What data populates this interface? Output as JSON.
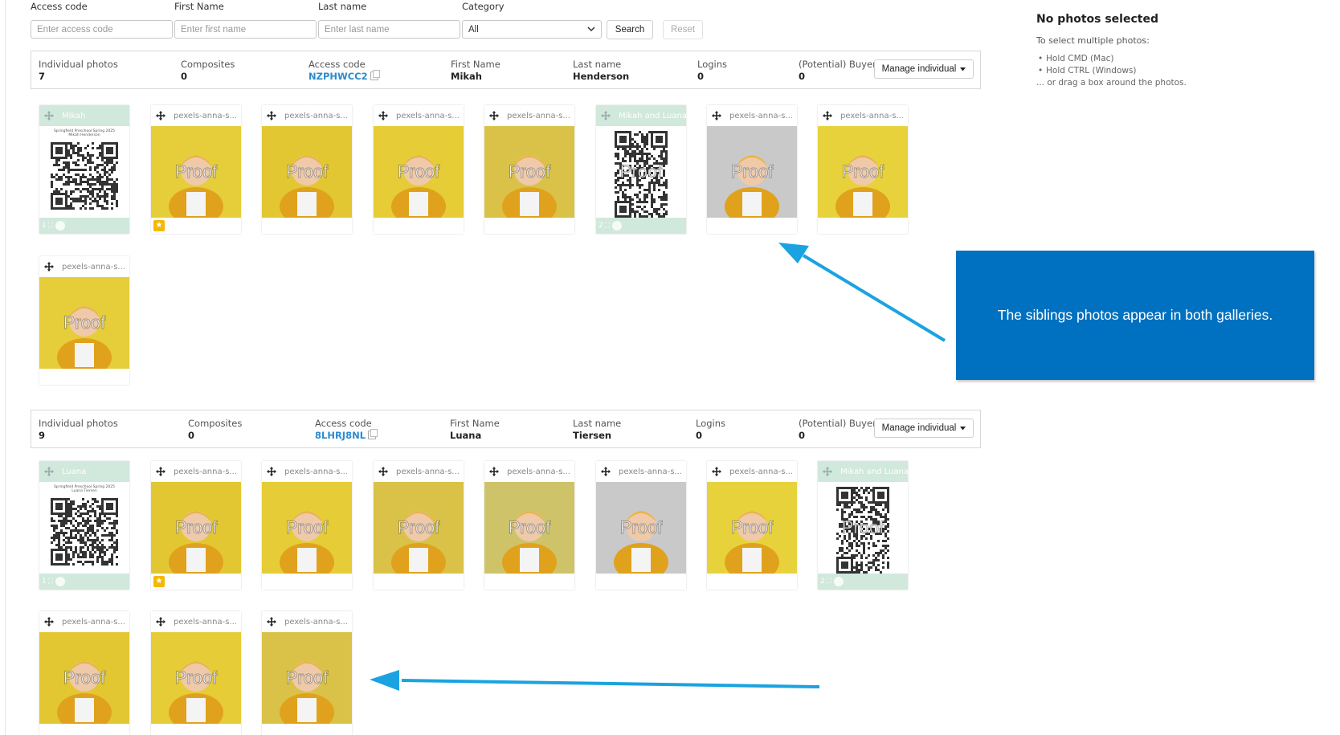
{
  "filters": {
    "access_code_label": "Access code",
    "access_code_placeholder": "Enter access code",
    "first_name_label": "First Name",
    "first_name_placeholder": "Enter first name",
    "last_name_label": "Last name",
    "last_name_placeholder": "Enter last name",
    "category_label": "Category",
    "category_value": "All",
    "search_label": "Search",
    "reset_label": "Reset"
  },
  "galleries": [
    {
      "headers": {
        "individual": "Individual photos",
        "composites": "Composites",
        "access_code": "Access code",
        "first_name": "First Name",
        "last_name": "Last name",
        "logins": "Logins",
        "buyer": "(Potential) Buyer"
      },
      "individual_count": "7",
      "composites_count": "0",
      "access_code": "NZPHWCC2",
      "first_name": "Mikah",
      "last_name": "Henderson",
      "logins": "0",
      "buyer": "0",
      "manage_label": "Manage individual",
      "cards": [
        {
          "title": "Mikah",
          "type": "composite",
          "badge": "1",
          "header_line": "Springfield Preschool Spring 2025",
          "sub_line": "Mikah Henderson"
        },
        {
          "title": "pexels-anna-s...",
          "type": "photo",
          "starred": true,
          "watermark": "Proof"
        },
        {
          "title": "pexels-anna-s...",
          "type": "photo",
          "watermark": "Proof"
        },
        {
          "title": "pexels-anna-s...",
          "type": "photo",
          "watermark": "Proof"
        },
        {
          "title": "pexels-anna-s...",
          "type": "photo",
          "watermark": "Proof"
        },
        {
          "title": "Mikah and Luana",
          "type": "composite",
          "badge": "2",
          "watermark": "Proof"
        },
        {
          "title": "pexels-anna-s...",
          "type": "photo",
          "watermark": "Proof"
        },
        {
          "title": "pexels-anna-s...",
          "type": "photo",
          "watermark": "Proof"
        },
        {
          "title": "pexels-anna-s...",
          "type": "photo",
          "watermark": "Proof"
        }
      ]
    },
    {
      "headers": {
        "individual": "Individual photos",
        "composites": "Composites",
        "access_code": "Access code",
        "first_name": "First Name",
        "last_name": "Last name",
        "logins": "Logins",
        "buyer": "(Potential) Buyer"
      },
      "individual_count": "9",
      "composites_count": "0",
      "access_code": "8LHRJ8NL",
      "first_name": "Luana",
      "last_name": "Tiersen",
      "logins": "0",
      "buyer": "0",
      "manage_label": "Manage individual",
      "cards": [
        {
          "title": "Luana",
          "type": "composite",
          "badge": "1",
          "header_line": "Springfield Preschool Spring 2025",
          "sub_line": "Luana Tiersen"
        },
        {
          "title": "pexels-anna-s...",
          "type": "photo",
          "starred": true,
          "watermark": "Proof"
        },
        {
          "title": "pexels-anna-s...",
          "type": "photo",
          "watermark": "Proof"
        },
        {
          "title": "pexels-anna-s...",
          "type": "photo",
          "watermark": "Proof"
        },
        {
          "title": "pexels-anna-s...",
          "type": "photo",
          "watermark": "Proof"
        },
        {
          "title": "pexels-anna-s...",
          "type": "photo",
          "watermark": "Proof"
        },
        {
          "title": "pexels-anna-s...",
          "type": "photo",
          "watermark": "Proof"
        },
        {
          "title": "Mikah and Luana",
          "type": "composite",
          "badge": "2",
          "watermark": "Proof"
        },
        {
          "title": "pexels-anna-s...",
          "type": "photo",
          "watermark": "Proof"
        },
        {
          "title": "pexels-anna-s...",
          "type": "photo",
          "watermark": "Proof"
        },
        {
          "title": "pexels-anna-s...",
          "type": "photo",
          "watermark": "Proof"
        }
      ]
    }
  ],
  "panel": {
    "title": "No photos selected",
    "intro": "To select multiple photos:",
    "tip1": "Hold CMD (Mac)",
    "tip2": "Hold CTRL (Windows)",
    "tip3": "... or drag a box around the photos."
  },
  "callout": {
    "text": "The siblings photos appear in both galleries."
  },
  "colors": {
    "accent_link": "#2a8bd1",
    "composite_tint": "#d1e8dc",
    "callout_bg": "#0070c0",
    "arrow": "#1aa3e0",
    "photo_bg": "#e6cd3a",
    "star": "#f5b800"
  }
}
